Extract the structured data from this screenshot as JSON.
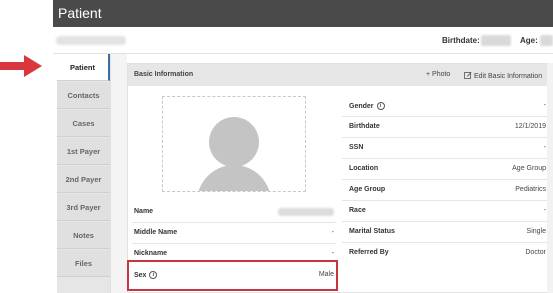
{
  "header": {
    "title": "Patient"
  },
  "subheader": {
    "birthdate_label": "Birthdate:",
    "age_label": "Age:"
  },
  "sidebar": {
    "tabs": [
      {
        "label": "Patient"
      },
      {
        "label": "Contacts"
      },
      {
        "label": "Cases"
      },
      {
        "label": "1st Payer"
      },
      {
        "label": "2nd Payer"
      },
      {
        "label": "3rd Payer"
      },
      {
        "label": "Notes"
      },
      {
        "label": "Files"
      }
    ]
  },
  "panel": {
    "title": "Basic Information",
    "add_photo": "+ Photo",
    "edit": "Edit Basic Information"
  },
  "left_fields": {
    "name_label": "Name",
    "middle_label": "Middle Name",
    "middle_value": "-",
    "nickname_label": "Nickname",
    "nickname_value": "-",
    "sex_label": "Sex",
    "sex_value": "Male"
  },
  "right_fields": {
    "gender_label": "Gender",
    "gender_value": "-",
    "birthdate_label": "Birthdate",
    "birthdate_value": "12/1/2019",
    "ssn_label": "SSN",
    "ssn_value": "-",
    "location_label": "Location",
    "location_value": "Age Group",
    "agegroup_label": "Age Group",
    "agegroup_value": "Pediatrics",
    "race_label": "Race",
    "race_value": "-",
    "marital_label": "Marital Status",
    "marital_value": "Single",
    "referred_label": "Referred By",
    "referred_value": "Doctor"
  },
  "colors": {
    "accent": "#3a6ea5",
    "callout": "#d9363e",
    "header": "#4a4a4a"
  }
}
